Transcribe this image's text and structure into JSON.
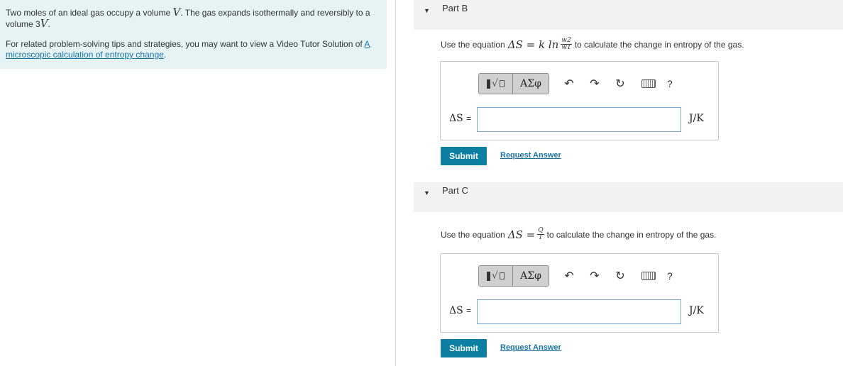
{
  "intro": {
    "text1_a": "Two moles of an ideal gas occupy a volume ",
    "var_V": "V",
    "text1_b": ". The gas expands isothermally and reversibly to a volume 3",
    "var_V2": "V",
    "text1_c": ".",
    "text2": "For related problem-solving tips and strategies, you may want to view a Video Tutor Solution of ",
    "link": "A microscopic calculation of entropy change",
    "text2_end": "."
  },
  "parts": [
    {
      "title": "Part B",
      "instr_prefix": "Use the equation",
      "eq_lhs": "ΔS = k ln",
      "frac_num": "w2",
      "frac_den": "w1",
      "instr_suffix": "to calculate the change in entropy of the gas.",
      "answer_label": "ΔS",
      "equals": "=",
      "answer_value": "",
      "unit": "J/K",
      "submit": "Submit",
      "request": "Request Answer"
    },
    {
      "title": "Part C",
      "instr_prefix": "Use the equation",
      "eq_lhs": "ΔS =",
      "frac_num": "Q",
      "frac_den": "T",
      "instr_suffix": "to calculate the change in entropy of the gas.",
      "answer_label": "ΔS",
      "equals": "=",
      "answer_value": "",
      "unit": "J/K",
      "submit": "Submit",
      "request": "Request Answer"
    }
  ],
  "toolbar": {
    "greek": "ΑΣφ",
    "help": "?",
    "icons": [
      "templates-icon",
      "greek-symbols-icon",
      "undo-icon",
      "redo-icon",
      "reset-icon",
      "keyboard-icon",
      "help-icon"
    ]
  },
  "colors": {
    "intro_bg": "#e5f3f5",
    "submit_bg": "#0d7fa3",
    "link": "#1a73a6"
  }
}
